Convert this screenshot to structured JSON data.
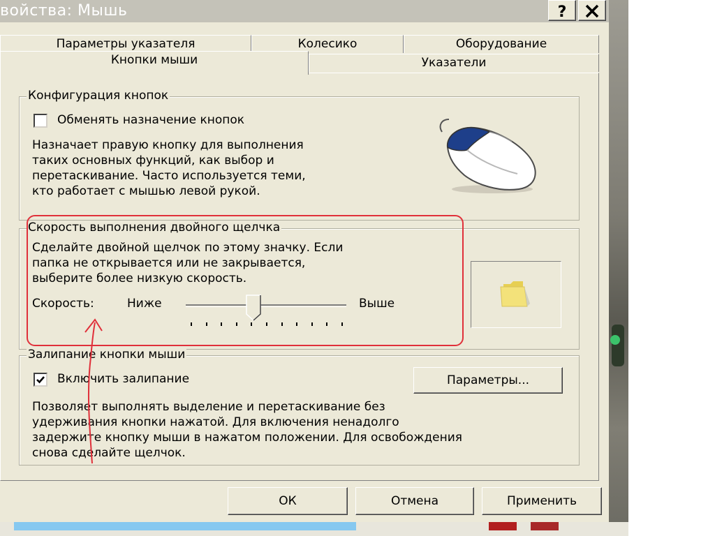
{
  "window": {
    "title": "войства: Мышь"
  },
  "titlebar": {
    "help_label": "?",
    "close_icon": "close-icon"
  },
  "tabs": {
    "back": [
      "Параметры указателя",
      "Колесико",
      "Оборудование"
    ],
    "front": [
      "Кнопки мыши",
      "Указатели"
    ],
    "active": "Кнопки мыши"
  },
  "button_config": {
    "legend": "Конфигурация кнопок",
    "swap_label": "Обменять назначение кнопок",
    "swap_checked": false,
    "description": [
      "Назначает правую кнопку для выполнения",
      "таких основных функций, как выбор и",
      "перетаскивание. Часто используется теми,",
      "кто работает с мышью левой рукой."
    ]
  },
  "double_click": {
    "legend": "Скорость выполнения двойного щелчка",
    "description": [
      "Сделайте двойной щелчок по этому значку. Если",
      "папка не открывается или не закрывается,",
      "выберите более низкую скорость."
    ],
    "speed_label": "Скорость:",
    "low_label": "Ниже",
    "high_label": "Выше",
    "slider_value_fraction": 0.42,
    "tick_count": 11
  },
  "click_lock": {
    "legend": "Залипание кнопки мыши",
    "enable_label": "Включить залипание",
    "enable_checked": true,
    "settings_button": "Параметры...",
    "description": [
      "Позволяет выполнять выделение и перетаскивание без",
      "удерживания кнопки нажатой. Для включения ненадолго",
      "задержите кнопку мыши в нажатом положении. Для освобождения",
      "снова сделайте щелчок."
    ]
  },
  "footer": {
    "ok": "ОК",
    "cancel": "Отмена",
    "apply": "Применить"
  },
  "colors": {
    "highlight": "#e0303a",
    "dialog_bg": "#ece9d8",
    "folder": "#f3e27a",
    "mouse_button": "#1e3f8a"
  }
}
